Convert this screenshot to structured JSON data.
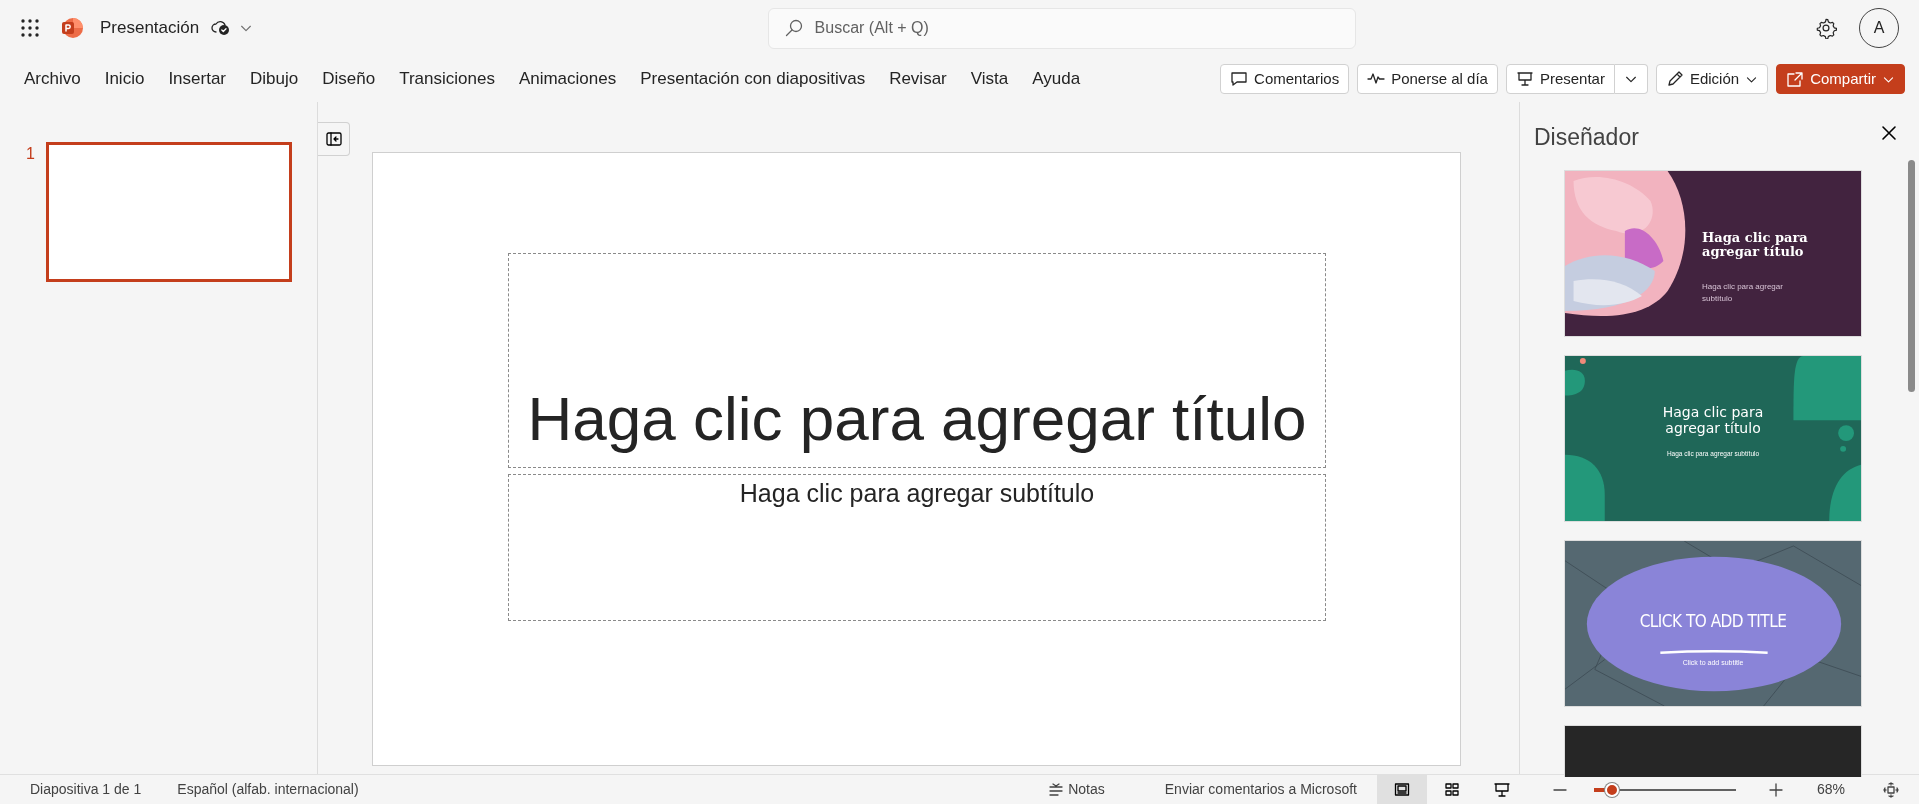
{
  "app": {
    "title": "Presentación",
    "search_placeholder": "Buscar (Alt + Q)",
    "avatar": "A"
  },
  "ribbon_tabs": [
    "Archivo",
    "Inicio",
    "Insertar",
    "Dibujo",
    "Diseño",
    "Transiciones",
    "Animaciones",
    "Presentación con diapositivas",
    "Revisar",
    "Vista",
    "Ayuda"
  ],
  "ribbon_buttons": [
    {
      "label": "Comentarios",
      "kind": "comments",
      "split": false,
      "dropdown": false,
      "primary": false
    },
    {
      "label": "Ponerse al día",
      "kind": "catchup",
      "split": false,
      "dropdown": false,
      "primary": false
    },
    {
      "label": "Presentar",
      "kind": "present",
      "split": true,
      "dropdown": false,
      "primary": false
    },
    {
      "label": "Edición",
      "kind": "edit",
      "split": false,
      "dropdown": true,
      "primary": false
    },
    {
      "label": "Compartir",
      "kind": "share",
      "split": false,
      "dropdown": true,
      "primary": true
    }
  ],
  "slides": [
    {
      "number": "1",
      "selected": true
    }
  ],
  "slide": {
    "title_placeholder": "Haga clic para agregar título",
    "subtitle_placeholder": "Haga clic para agregar subtítulo"
  },
  "designer": {
    "title": "Diseñador",
    "designs": [
      {
        "kind": "watercolor",
        "title": "Haga clic para agregar título",
        "subtitle": "Haga clic para agregar subtítulo"
      },
      {
        "kind": "leaves",
        "title": "Haga clic para agregar título",
        "subtitle": "Haga clic para agregar subtítulo"
      },
      {
        "kind": "network",
        "title": "CLICK TO ADD TITLE",
        "subtitle": "Click to add subtitle"
      },
      {
        "kind": "dark"
      }
    ]
  },
  "status_bar": {
    "slide_count": "Diapositiva 1 de 1",
    "language": "Español (alfab. internacional)",
    "notes": "Notas",
    "feedback": "Enviar comentarios a Microsoft",
    "views": [
      {
        "kind": "normal",
        "selected": true
      },
      {
        "kind": "sorter",
        "selected": false
      },
      {
        "kind": "reading",
        "selected": false
      }
    ],
    "zoom": {
      "level": 0.13,
      "reading": "68%"
    }
  }
}
